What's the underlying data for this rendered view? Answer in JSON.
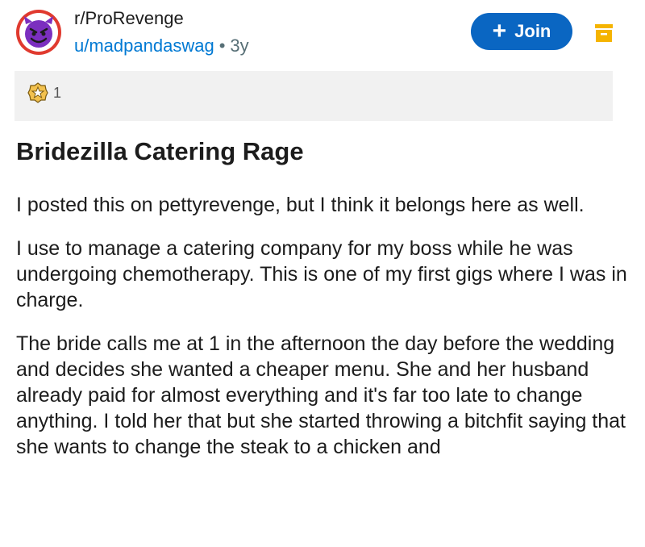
{
  "header": {
    "subreddit": "r/ProRevenge",
    "username": "u/madpandaswag",
    "separator": "•",
    "age": "3y",
    "join_label": "Join",
    "join_plus": "+"
  },
  "award": {
    "count": "1"
  },
  "post": {
    "title": "Bridezilla Catering Rage",
    "paragraphs": [
      "I posted this on pettyrevenge, but I think it belongs here as well.",
      "I use to manage a catering company for my boss while he was undergoing chemotherapy. This is one of my first gigs where I was in charge.",
      "The bride calls me at 1 in the afternoon the day before the wedding and decides she wanted a cheaper menu. She and her husband already paid for almost everything and it's far too late to change anything. I told her that but she started throwing a bitchfit saying that she wants to change the steak to a chicken and"
    ]
  },
  "colors": {
    "accent": "#0a66c2",
    "username": "#0079d3",
    "avatar_ring": "#e03a2f",
    "avatar_face": "#7b2fbf",
    "archive_icon": "#f5b400",
    "award_bar": "#f1f1f1"
  },
  "icons": {
    "avatar": "devil-face-icon",
    "join": "plus-icon",
    "archive": "archive-icon",
    "award": "award-star-icon"
  }
}
